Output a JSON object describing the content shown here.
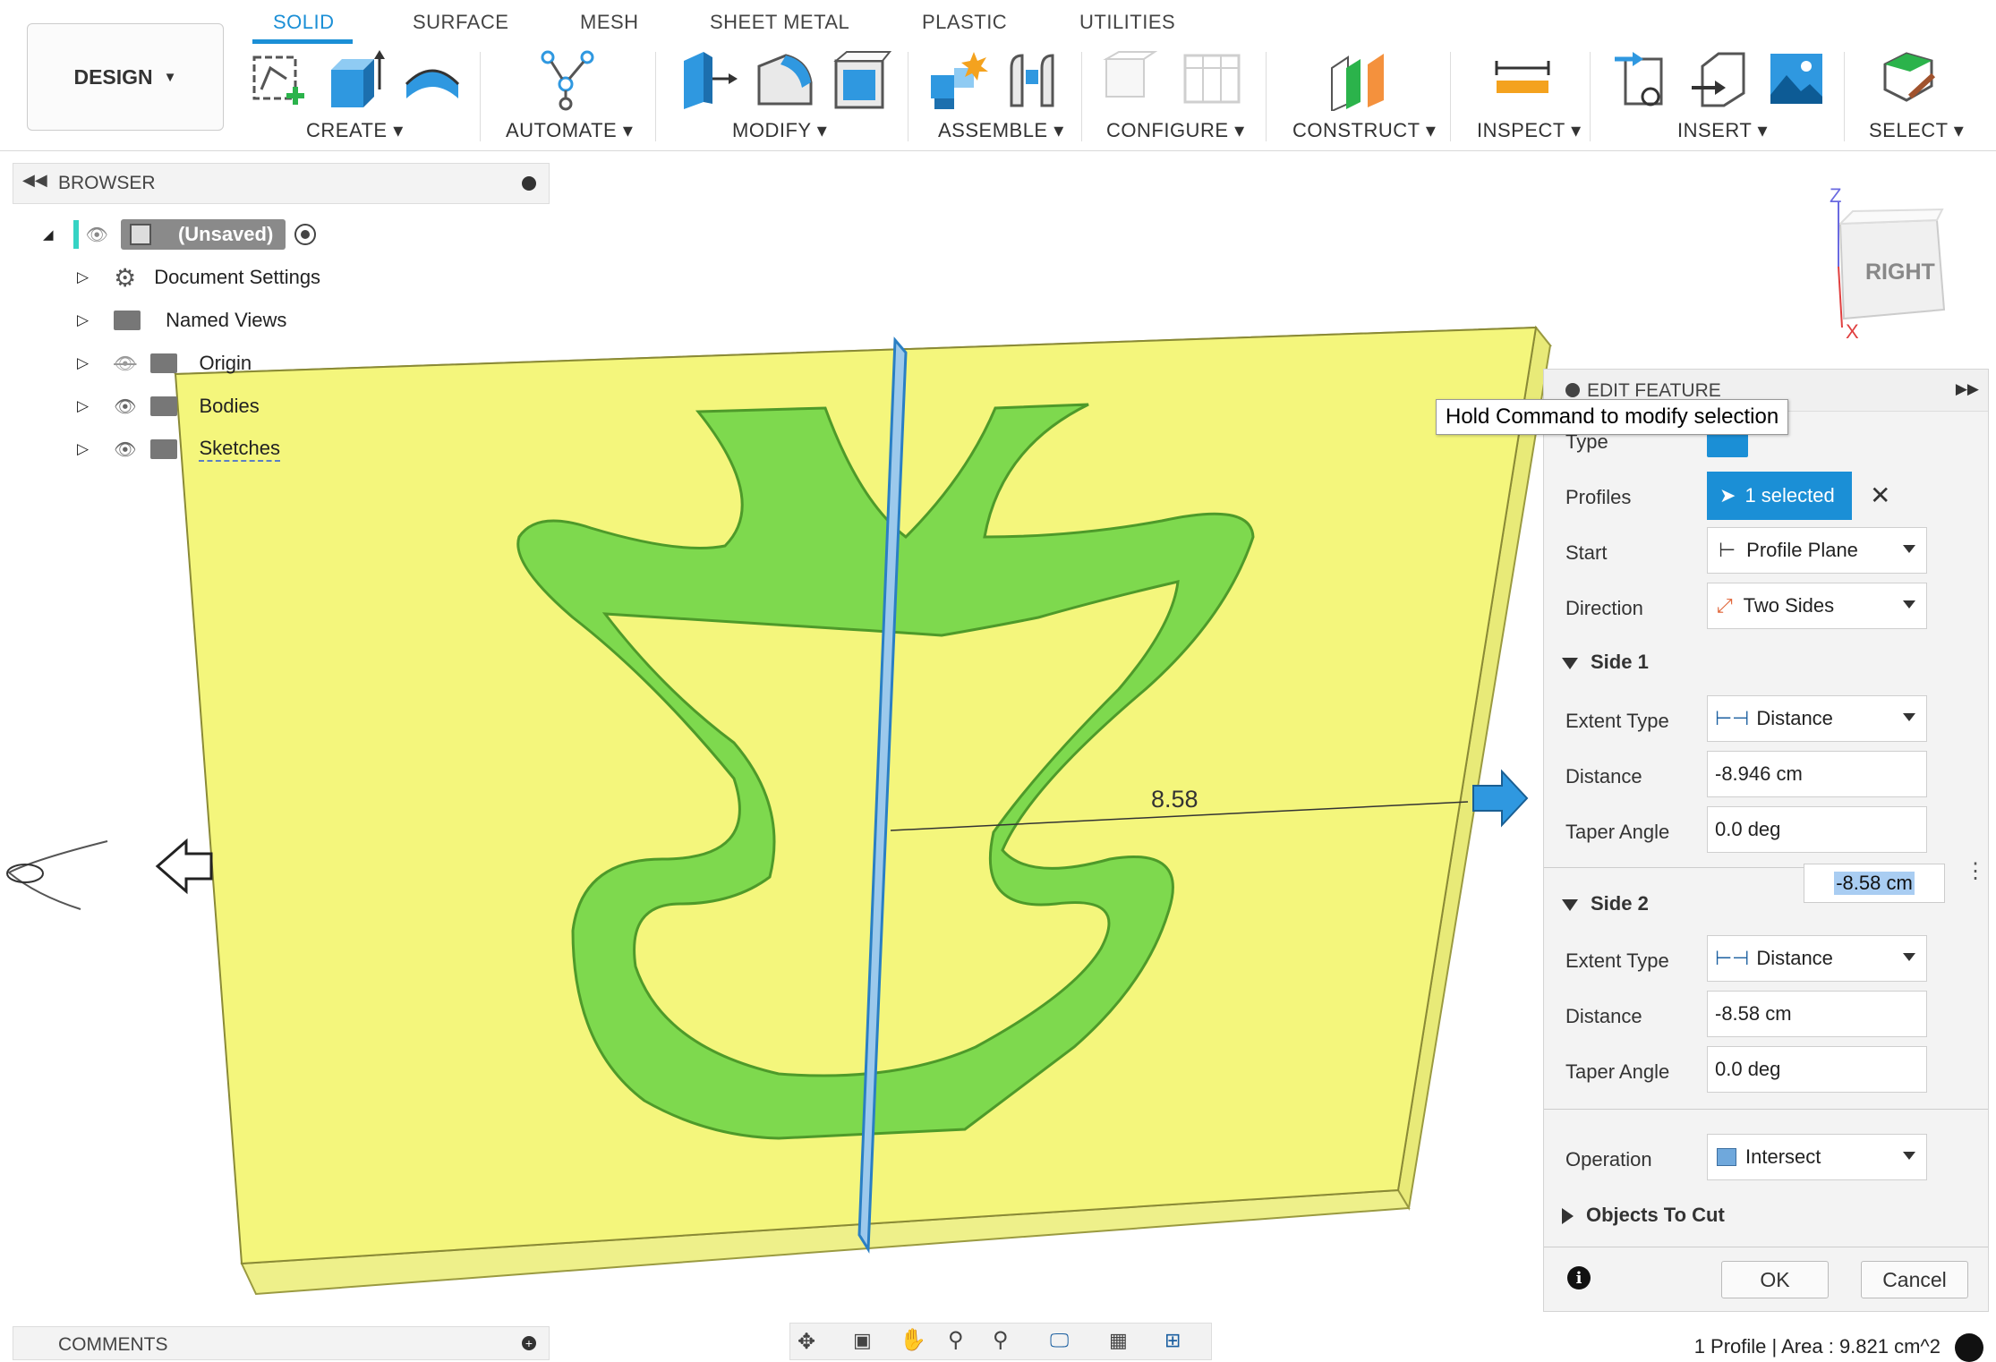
{
  "toolbar": {
    "tabs": [
      "SOLID",
      "SURFACE",
      "MESH",
      "SHEET METAL",
      "PLASTIC",
      "UTILITIES"
    ],
    "active_tab": "SOLID",
    "workspace": "DESIGN",
    "groups": [
      "CREATE",
      "AUTOMATE",
      "MODIFY",
      "ASSEMBLE",
      "CONFIGURE",
      "CONSTRUCT",
      "INSPECT",
      "INSERT",
      "SELECT"
    ]
  },
  "browser": {
    "title": "BROWSER",
    "root": "(Unsaved)",
    "items": [
      "Document Settings",
      "Named Views",
      "Origin",
      "Bodies",
      "Sketches"
    ]
  },
  "viewcube": {
    "face": "RIGHT",
    "axis_z": "Z",
    "axis_x": "X"
  },
  "viewport": {
    "dimension_label": "8.58"
  },
  "tooltip": "Hold Command to modify selection",
  "edit_feature": {
    "title": "EDIT FEATURE",
    "type_label": "Type",
    "profiles_label": "Profiles",
    "profiles_value": "1 selected",
    "start_label": "Start",
    "start_value": "Profile Plane",
    "direction_label": "Direction",
    "direction_value": "Two Sides",
    "side1": {
      "title": "Side 1",
      "extent_label": "Extent Type",
      "extent_value": "Distance",
      "distance_label": "Distance",
      "distance_value": "-8.946 cm",
      "taper_label": "Taper Angle",
      "taper_value": "0.0 deg"
    },
    "inline_input_value": "-8.58 cm",
    "side2": {
      "title": "Side 2",
      "extent_label": "Extent Type",
      "extent_value": "Distance",
      "distance_label": "Distance",
      "distance_value": "-8.58 cm",
      "taper_label": "Taper Angle",
      "taper_value": "0.0 deg"
    },
    "operation_label": "Operation",
    "operation_value": "Intersect",
    "objects_to_cut": "Objects To Cut",
    "ok": "OK",
    "cancel": "Cancel"
  },
  "comments": {
    "title": "COMMENTS"
  },
  "status": "1 Profile | Area : 9.821 cm^2",
  "colors": {
    "accent": "#1b8fd6",
    "plate": "#f3f57a",
    "body": "#7fd84a",
    "selected": "#1b8fd6"
  }
}
